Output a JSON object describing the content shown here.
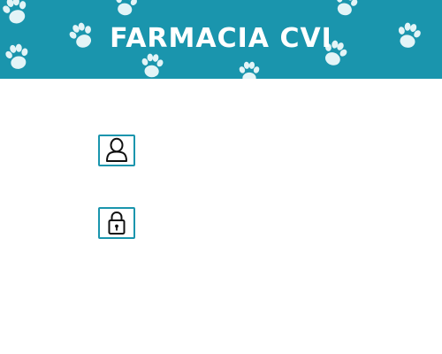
{
  "header": {
    "title": "FARMACIA CVI",
    "background_color": "#1a95ad",
    "pattern_color": "#e3f4f7",
    "pattern_icon": "paw-print-icon"
  },
  "login": {
    "username_icon": "user-icon",
    "password_icon": "lock-icon",
    "username_value": "",
    "password_value": "",
    "accent_color": "#1a95ad"
  }
}
